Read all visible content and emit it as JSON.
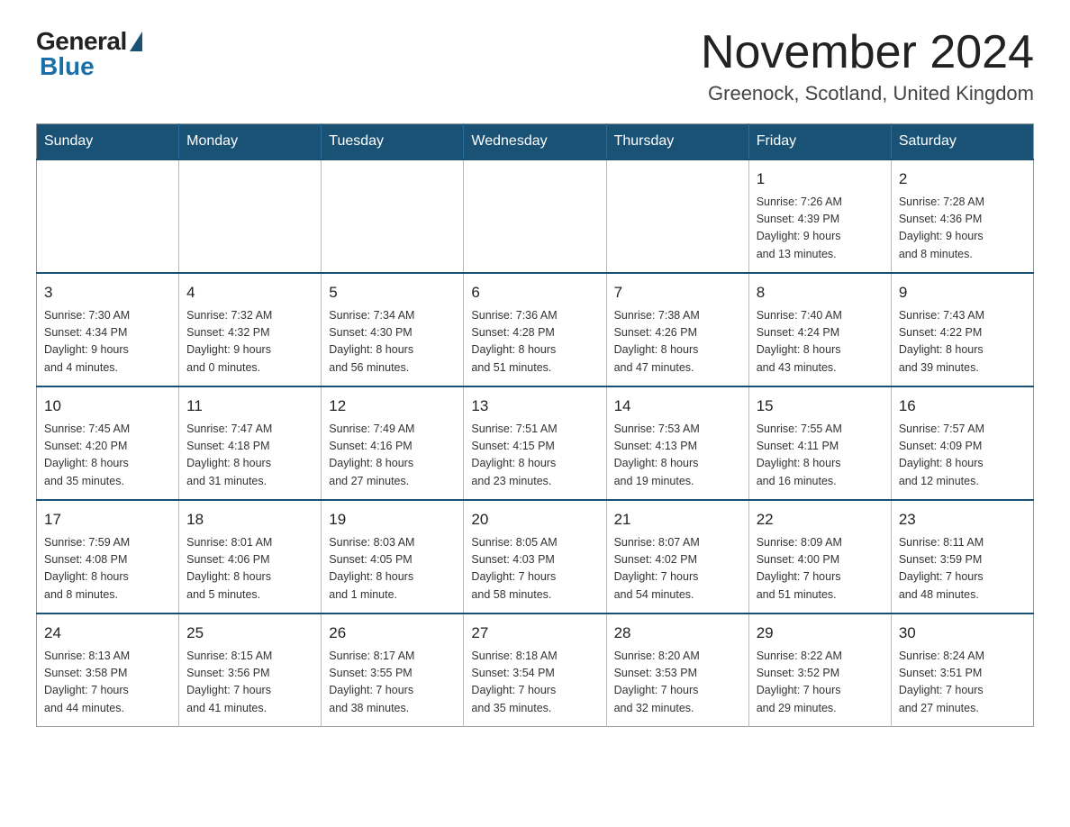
{
  "logo": {
    "general": "General",
    "blue": "Blue"
  },
  "title": "November 2024",
  "location": "Greenock, Scotland, United Kingdom",
  "days_of_week": [
    "Sunday",
    "Monday",
    "Tuesday",
    "Wednesday",
    "Thursday",
    "Friday",
    "Saturday"
  ],
  "weeks": [
    {
      "days": [
        {
          "num": "",
          "info": ""
        },
        {
          "num": "",
          "info": ""
        },
        {
          "num": "",
          "info": ""
        },
        {
          "num": "",
          "info": ""
        },
        {
          "num": "",
          "info": ""
        },
        {
          "num": "1",
          "info": "Sunrise: 7:26 AM\nSunset: 4:39 PM\nDaylight: 9 hours\nand 13 minutes."
        },
        {
          "num": "2",
          "info": "Sunrise: 7:28 AM\nSunset: 4:36 PM\nDaylight: 9 hours\nand 8 minutes."
        }
      ]
    },
    {
      "days": [
        {
          "num": "3",
          "info": "Sunrise: 7:30 AM\nSunset: 4:34 PM\nDaylight: 9 hours\nand 4 minutes."
        },
        {
          "num": "4",
          "info": "Sunrise: 7:32 AM\nSunset: 4:32 PM\nDaylight: 9 hours\nand 0 minutes."
        },
        {
          "num": "5",
          "info": "Sunrise: 7:34 AM\nSunset: 4:30 PM\nDaylight: 8 hours\nand 56 minutes."
        },
        {
          "num": "6",
          "info": "Sunrise: 7:36 AM\nSunset: 4:28 PM\nDaylight: 8 hours\nand 51 minutes."
        },
        {
          "num": "7",
          "info": "Sunrise: 7:38 AM\nSunset: 4:26 PM\nDaylight: 8 hours\nand 47 minutes."
        },
        {
          "num": "8",
          "info": "Sunrise: 7:40 AM\nSunset: 4:24 PM\nDaylight: 8 hours\nand 43 minutes."
        },
        {
          "num": "9",
          "info": "Sunrise: 7:43 AM\nSunset: 4:22 PM\nDaylight: 8 hours\nand 39 minutes."
        }
      ]
    },
    {
      "days": [
        {
          "num": "10",
          "info": "Sunrise: 7:45 AM\nSunset: 4:20 PM\nDaylight: 8 hours\nand 35 minutes."
        },
        {
          "num": "11",
          "info": "Sunrise: 7:47 AM\nSunset: 4:18 PM\nDaylight: 8 hours\nand 31 minutes."
        },
        {
          "num": "12",
          "info": "Sunrise: 7:49 AM\nSunset: 4:16 PM\nDaylight: 8 hours\nand 27 minutes."
        },
        {
          "num": "13",
          "info": "Sunrise: 7:51 AM\nSunset: 4:15 PM\nDaylight: 8 hours\nand 23 minutes."
        },
        {
          "num": "14",
          "info": "Sunrise: 7:53 AM\nSunset: 4:13 PM\nDaylight: 8 hours\nand 19 minutes."
        },
        {
          "num": "15",
          "info": "Sunrise: 7:55 AM\nSunset: 4:11 PM\nDaylight: 8 hours\nand 16 minutes."
        },
        {
          "num": "16",
          "info": "Sunrise: 7:57 AM\nSunset: 4:09 PM\nDaylight: 8 hours\nand 12 minutes."
        }
      ]
    },
    {
      "days": [
        {
          "num": "17",
          "info": "Sunrise: 7:59 AM\nSunset: 4:08 PM\nDaylight: 8 hours\nand 8 minutes."
        },
        {
          "num": "18",
          "info": "Sunrise: 8:01 AM\nSunset: 4:06 PM\nDaylight: 8 hours\nand 5 minutes."
        },
        {
          "num": "19",
          "info": "Sunrise: 8:03 AM\nSunset: 4:05 PM\nDaylight: 8 hours\nand 1 minute."
        },
        {
          "num": "20",
          "info": "Sunrise: 8:05 AM\nSunset: 4:03 PM\nDaylight: 7 hours\nand 58 minutes."
        },
        {
          "num": "21",
          "info": "Sunrise: 8:07 AM\nSunset: 4:02 PM\nDaylight: 7 hours\nand 54 minutes."
        },
        {
          "num": "22",
          "info": "Sunrise: 8:09 AM\nSunset: 4:00 PM\nDaylight: 7 hours\nand 51 minutes."
        },
        {
          "num": "23",
          "info": "Sunrise: 8:11 AM\nSunset: 3:59 PM\nDaylight: 7 hours\nand 48 minutes."
        }
      ]
    },
    {
      "days": [
        {
          "num": "24",
          "info": "Sunrise: 8:13 AM\nSunset: 3:58 PM\nDaylight: 7 hours\nand 44 minutes."
        },
        {
          "num": "25",
          "info": "Sunrise: 8:15 AM\nSunset: 3:56 PM\nDaylight: 7 hours\nand 41 minutes."
        },
        {
          "num": "26",
          "info": "Sunrise: 8:17 AM\nSunset: 3:55 PM\nDaylight: 7 hours\nand 38 minutes."
        },
        {
          "num": "27",
          "info": "Sunrise: 8:18 AM\nSunset: 3:54 PM\nDaylight: 7 hours\nand 35 minutes."
        },
        {
          "num": "28",
          "info": "Sunrise: 8:20 AM\nSunset: 3:53 PM\nDaylight: 7 hours\nand 32 minutes."
        },
        {
          "num": "29",
          "info": "Sunrise: 8:22 AM\nSunset: 3:52 PM\nDaylight: 7 hours\nand 29 minutes."
        },
        {
          "num": "30",
          "info": "Sunrise: 8:24 AM\nSunset: 3:51 PM\nDaylight: 7 hours\nand 27 minutes."
        }
      ]
    }
  ]
}
